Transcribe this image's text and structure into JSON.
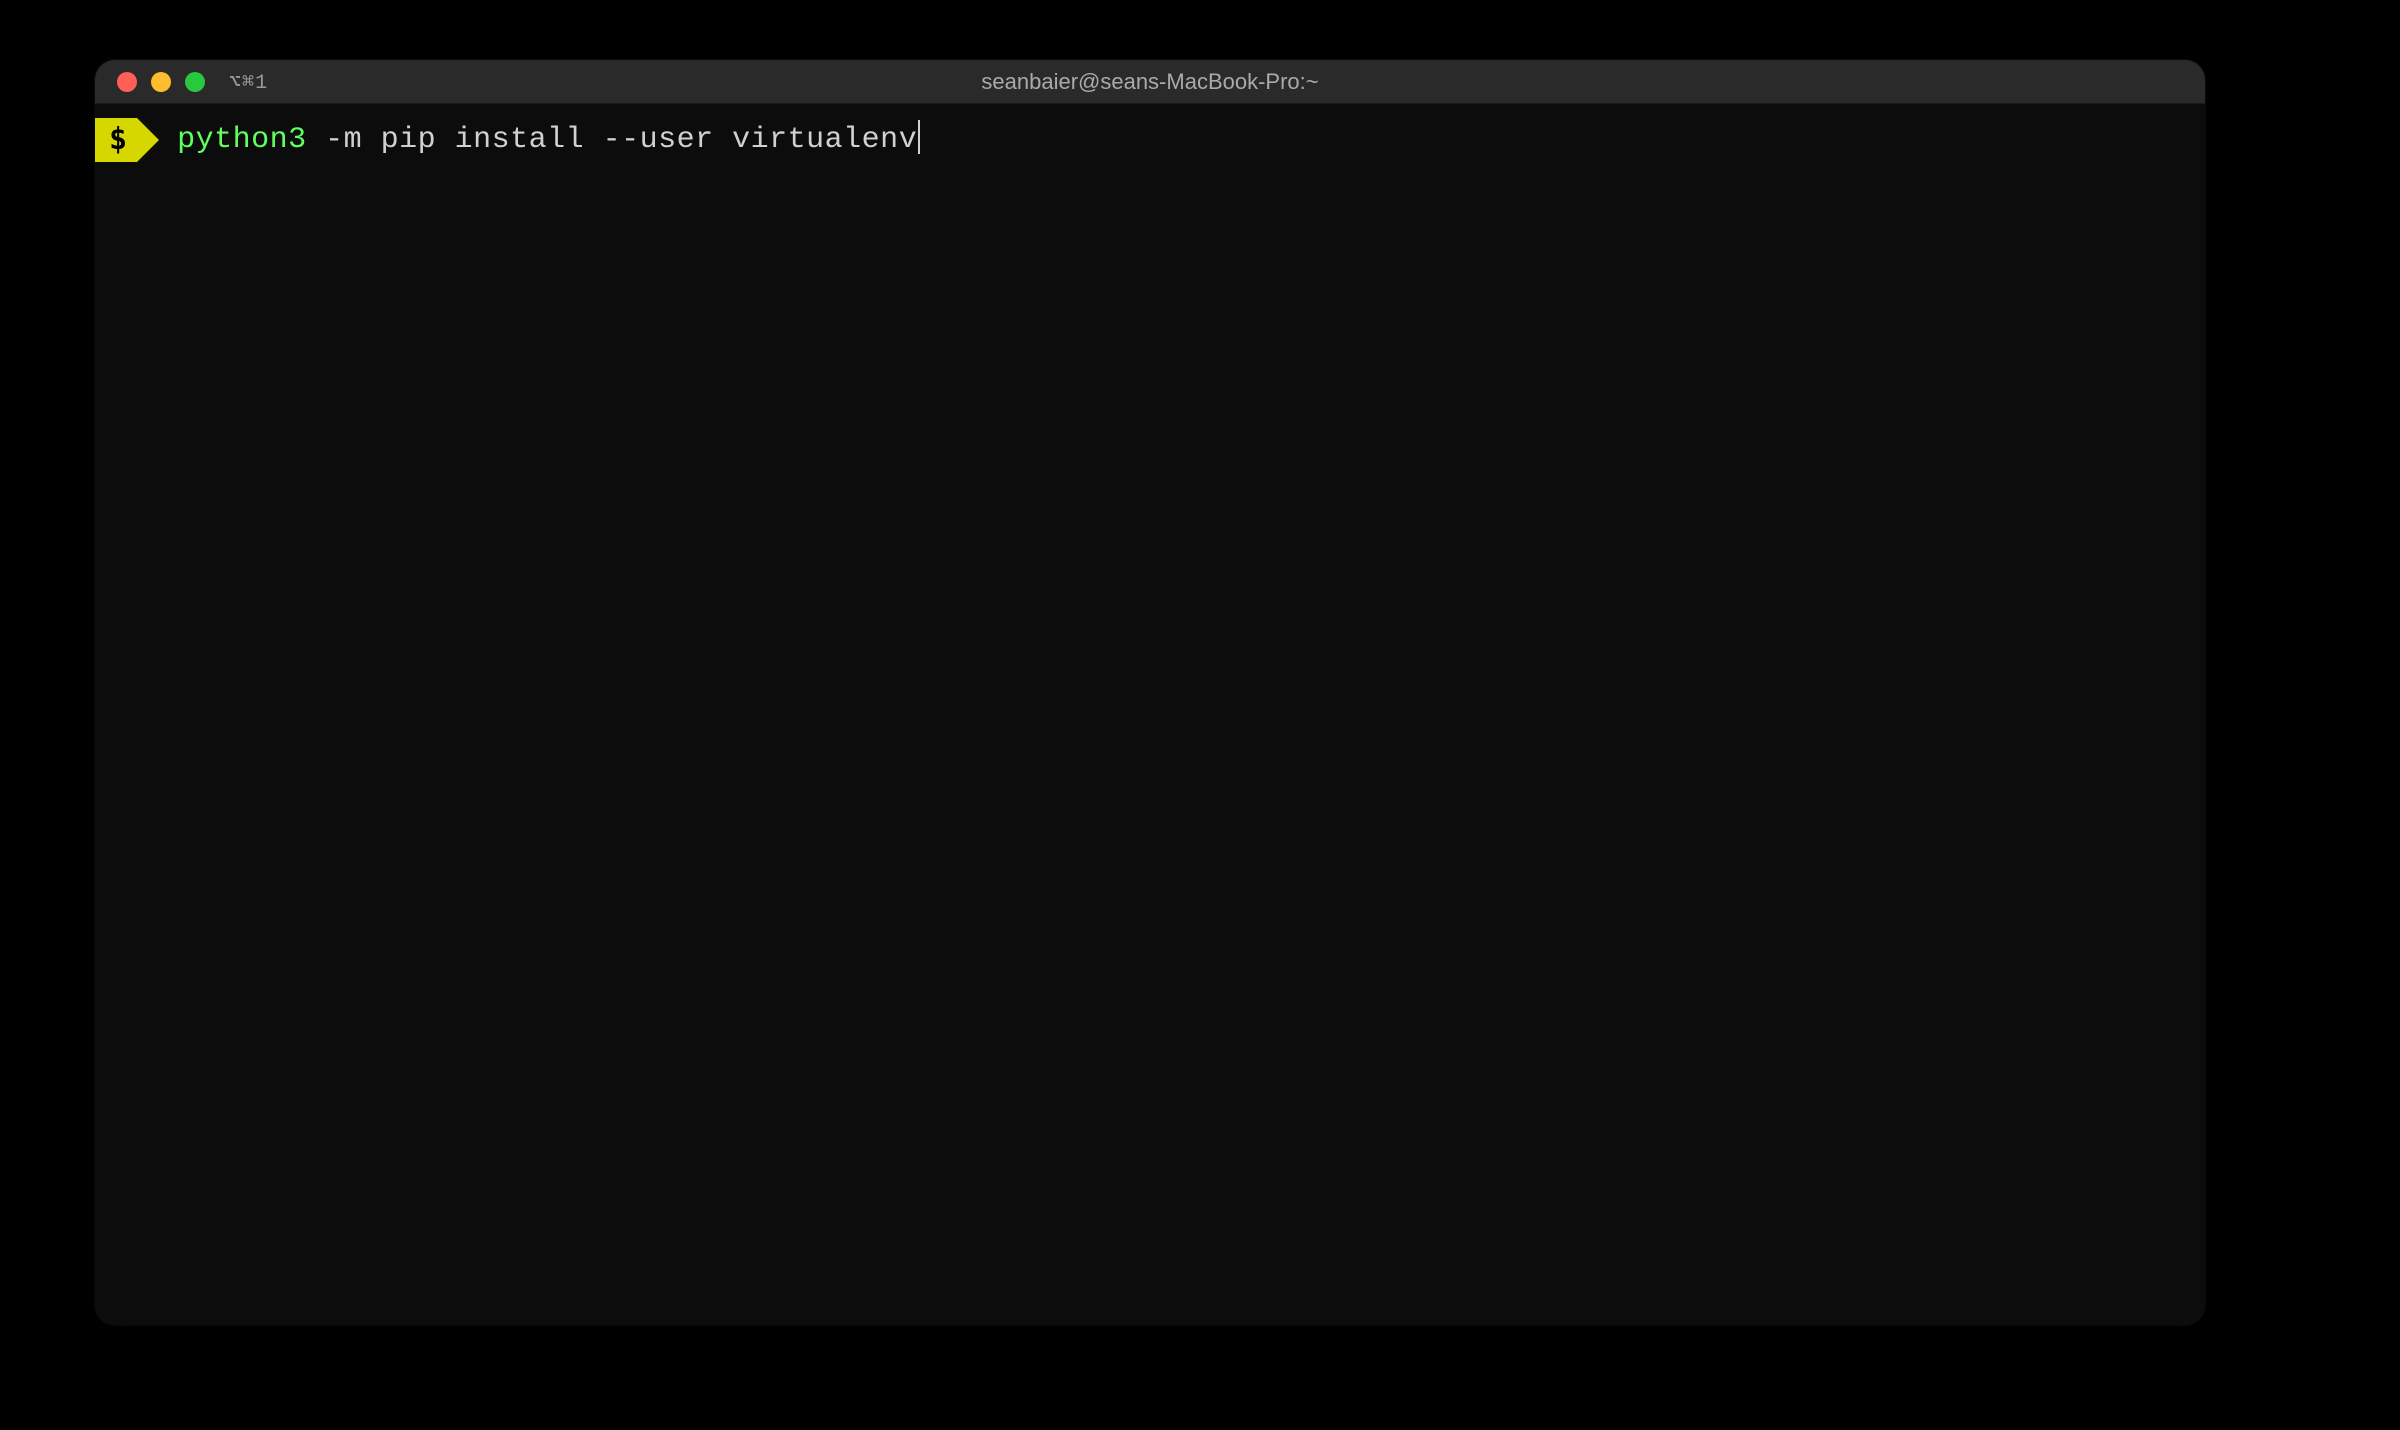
{
  "window": {
    "title": "seanbaier@seans-MacBook-Pro:~",
    "tab_indicator": "⌥⌘1"
  },
  "prompt": {
    "symbol": "$"
  },
  "command": {
    "executable": "python3",
    "args": " -m pip install --user virtualenv"
  },
  "colors": {
    "prompt_bg": "#d7d700",
    "prompt_fg": "#000000",
    "executable_color": "#5fff5f",
    "text_color": "#d0d0d0",
    "terminal_bg": "#0c0c0c"
  }
}
